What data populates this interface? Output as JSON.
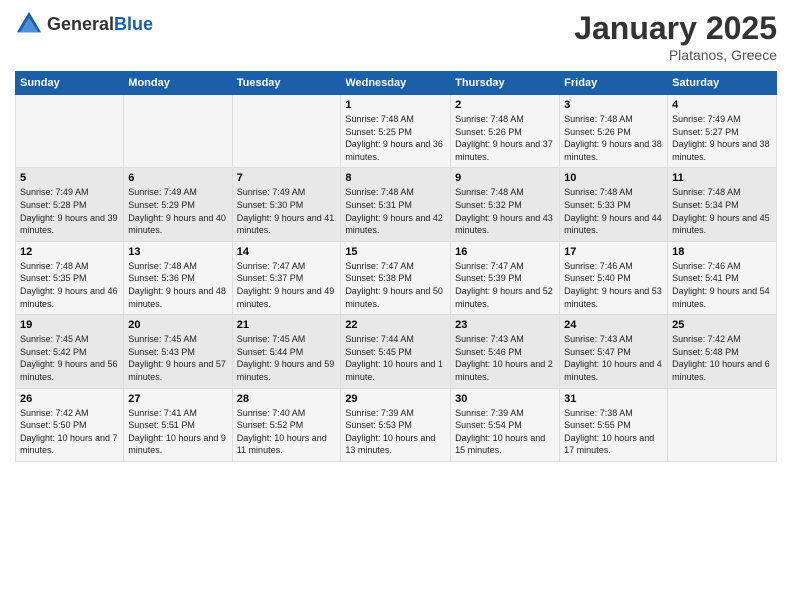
{
  "logo": {
    "text_general": "General",
    "text_blue": "Blue"
  },
  "header": {
    "month": "January 2025",
    "location": "Platanos, Greece"
  },
  "weekdays": [
    "Sunday",
    "Monday",
    "Tuesday",
    "Wednesday",
    "Thursday",
    "Friday",
    "Saturday"
  ],
  "weeks": [
    [
      {
        "day": "",
        "content": ""
      },
      {
        "day": "",
        "content": ""
      },
      {
        "day": "",
        "content": ""
      },
      {
        "day": "1",
        "content": "Sunrise: 7:48 AM\nSunset: 5:25 PM\nDaylight: 9 hours and 36 minutes."
      },
      {
        "day": "2",
        "content": "Sunrise: 7:48 AM\nSunset: 5:26 PM\nDaylight: 9 hours and 37 minutes."
      },
      {
        "day": "3",
        "content": "Sunrise: 7:48 AM\nSunset: 5:26 PM\nDaylight: 9 hours and 38 minutes."
      },
      {
        "day": "4",
        "content": "Sunrise: 7:49 AM\nSunset: 5:27 PM\nDaylight: 9 hours and 38 minutes."
      }
    ],
    [
      {
        "day": "5",
        "content": "Sunrise: 7:49 AM\nSunset: 5:28 PM\nDaylight: 9 hours and 39 minutes."
      },
      {
        "day": "6",
        "content": "Sunrise: 7:49 AM\nSunset: 5:29 PM\nDaylight: 9 hours and 40 minutes."
      },
      {
        "day": "7",
        "content": "Sunrise: 7:49 AM\nSunset: 5:30 PM\nDaylight: 9 hours and 41 minutes."
      },
      {
        "day": "8",
        "content": "Sunrise: 7:48 AM\nSunset: 5:31 PM\nDaylight: 9 hours and 42 minutes."
      },
      {
        "day": "9",
        "content": "Sunrise: 7:48 AM\nSunset: 5:32 PM\nDaylight: 9 hours and 43 minutes."
      },
      {
        "day": "10",
        "content": "Sunrise: 7:48 AM\nSunset: 5:33 PM\nDaylight: 9 hours and 44 minutes."
      },
      {
        "day": "11",
        "content": "Sunrise: 7:48 AM\nSunset: 5:34 PM\nDaylight: 9 hours and 45 minutes."
      }
    ],
    [
      {
        "day": "12",
        "content": "Sunrise: 7:48 AM\nSunset: 5:35 PM\nDaylight: 9 hours and 46 minutes."
      },
      {
        "day": "13",
        "content": "Sunrise: 7:48 AM\nSunset: 5:36 PM\nDaylight: 9 hours and 48 minutes."
      },
      {
        "day": "14",
        "content": "Sunrise: 7:47 AM\nSunset: 5:37 PM\nDaylight: 9 hours and 49 minutes."
      },
      {
        "day": "15",
        "content": "Sunrise: 7:47 AM\nSunset: 5:38 PM\nDaylight: 9 hours and 50 minutes."
      },
      {
        "day": "16",
        "content": "Sunrise: 7:47 AM\nSunset: 5:39 PM\nDaylight: 9 hours and 52 minutes."
      },
      {
        "day": "17",
        "content": "Sunrise: 7:46 AM\nSunset: 5:40 PM\nDaylight: 9 hours and 53 minutes."
      },
      {
        "day": "18",
        "content": "Sunrise: 7:46 AM\nSunset: 5:41 PM\nDaylight: 9 hours and 54 minutes."
      }
    ],
    [
      {
        "day": "19",
        "content": "Sunrise: 7:45 AM\nSunset: 5:42 PM\nDaylight: 9 hours and 56 minutes."
      },
      {
        "day": "20",
        "content": "Sunrise: 7:45 AM\nSunset: 5:43 PM\nDaylight: 9 hours and 57 minutes."
      },
      {
        "day": "21",
        "content": "Sunrise: 7:45 AM\nSunset: 5:44 PM\nDaylight: 9 hours and 59 minutes."
      },
      {
        "day": "22",
        "content": "Sunrise: 7:44 AM\nSunset: 5:45 PM\nDaylight: 10 hours and 1 minute."
      },
      {
        "day": "23",
        "content": "Sunrise: 7:43 AM\nSunset: 5:46 PM\nDaylight: 10 hours and 2 minutes."
      },
      {
        "day": "24",
        "content": "Sunrise: 7:43 AM\nSunset: 5:47 PM\nDaylight: 10 hours and 4 minutes."
      },
      {
        "day": "25",
        "content": "Sunrise: 7:42 AM\nSunset: 5:48 PM\nDaylight: 10 hours and 6 minutes."
      }
    ],
    [
      {
        "day": "26",
        "content": "Sunrise: 7:42 AM\nSunset: 5:50 PM\nDaylight: 10 hours and 7 minutes."
      },
      {
        "day": "27",
        "content": "Sunrise: 7:41 AM\nSunset: 5:51 PM\nDaylight: 10 hours and 9 minutes."
      },
      {
        "day": "28",
        "content": "Sunrise: 7:40 AM\nSunset: 5:52 PM\nDaylight: 10 hours and 11 minutes."
      },
      {
        "day": "29",
        "content": "Sunrise: 7:39 AM\nSunset: 5:53 PM\nDaylight: 10 hours and 13 minutes."
      },
      {
        "day": "30",
        "content": "Sunrise: 7:39 AM\nSunset: 5:54 PM\nDaylight: 10 hours and 15 minutes."
      },
      {
        "day": "31",
        "content": "Sunrise: 7:38 AM\nSunset: 5:55 PM\nDaylight: 10 hours and 17 minutes."
      },
      {
        "day": "",
        "content": ""
      }
    ]
  ]
}
